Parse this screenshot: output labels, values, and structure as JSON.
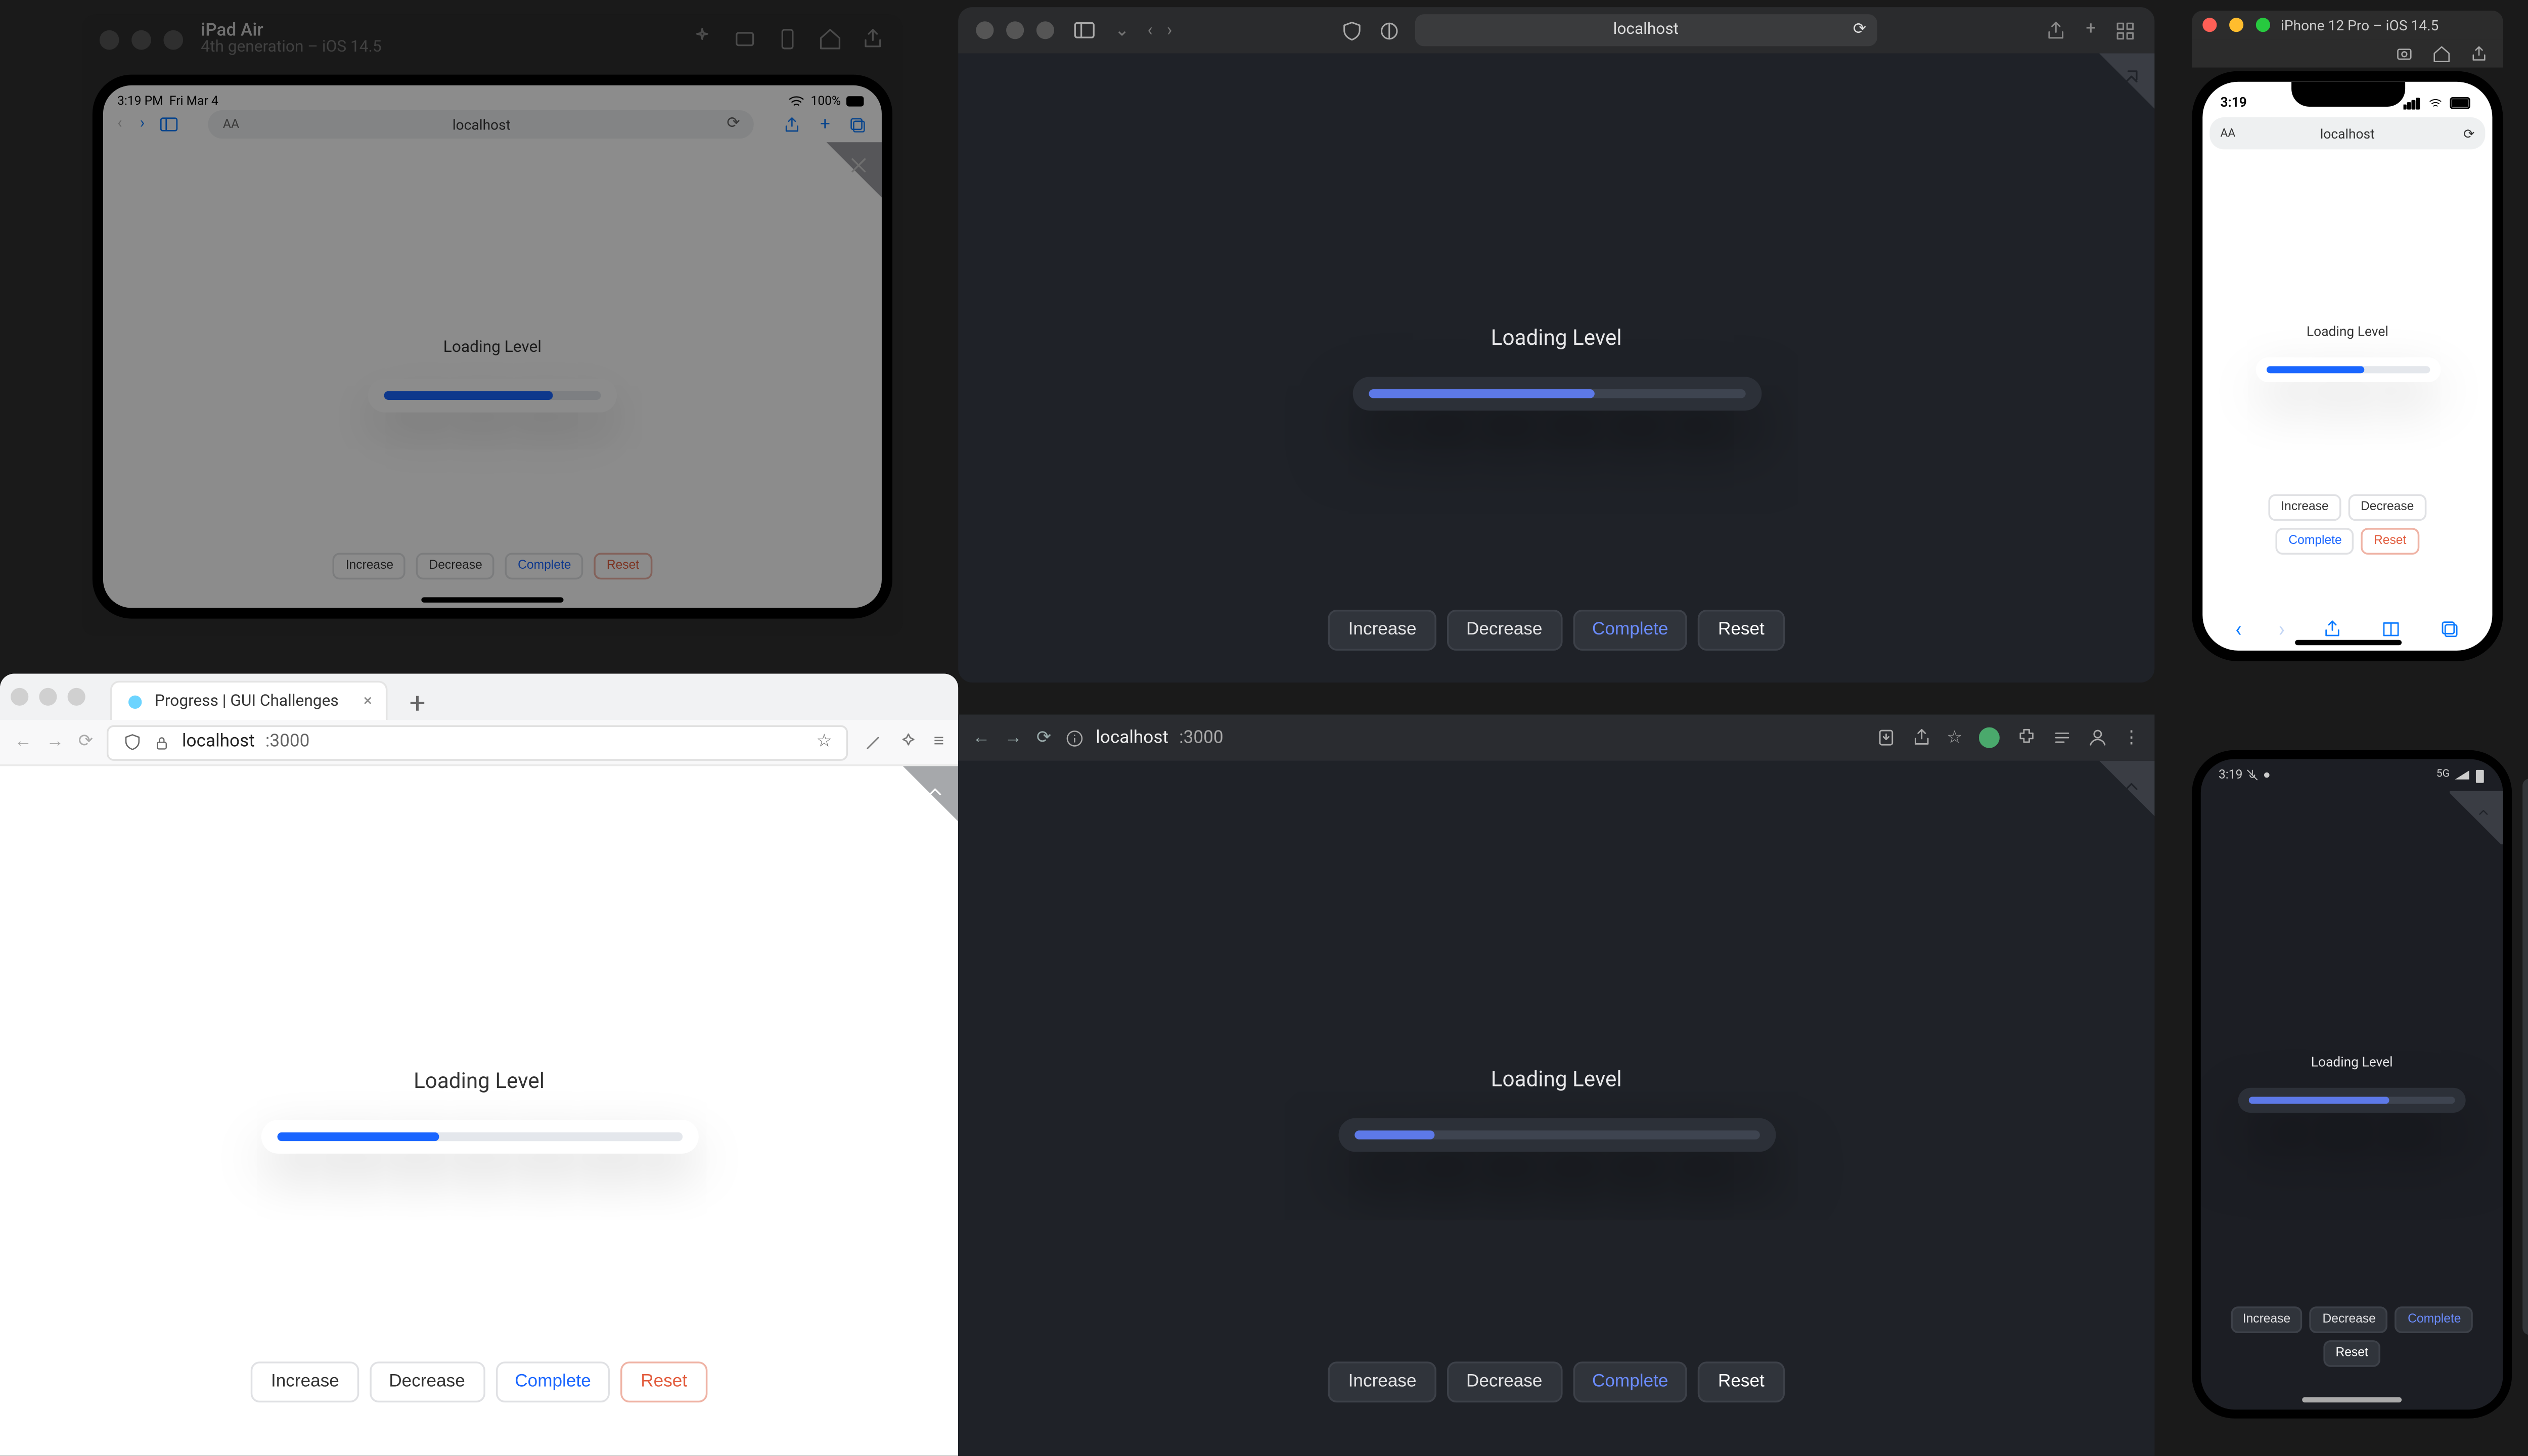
{
  "app": {
    "title": "Loading Level",
    "btn_increase": "Increase",
    "btn_decrease": "Decrease",
    "btn_complete": "Complete",
    "btn_reset": "Reset"
  },
  "ipad_sim": {
    "title": "iPad Air",
    "subtitle": "4th generation – iOS 14.5",
    "status_time": "3:19 PM",
    "status_date": "Fri Mar 4",
    "status_batt": "100%",
    "url": "localhost",
    "progress_pct": 78
  },
  "iphone_sim": {
    "title": "iPhone 12 Pro – iOS 14.5",
    "status_time": "3:19",
    "url": "localhost",
    "progress_pct": 60
  },
  "safari_main": {
    "url": "localhost",
    "progress_pct": 60
  },
  "firefox": {
    "tab_title": "Progress | GUI Challenges",
    "host": "localhost",
    "port": ":3000",
    "progress_pct": 40
  },
  "chrome": {
    "host": "localhost",
    "port": ":3000",
    "progress_pct": 20
  },
  "android": {
    "status_time": "3:19",
    "progress_pct": 68
  },
  "colors": {
    "accent_light": "#1a66ff",
    "accent_dark": "#5d79e8",
    "reset": "#e25b3c"
  }
}
